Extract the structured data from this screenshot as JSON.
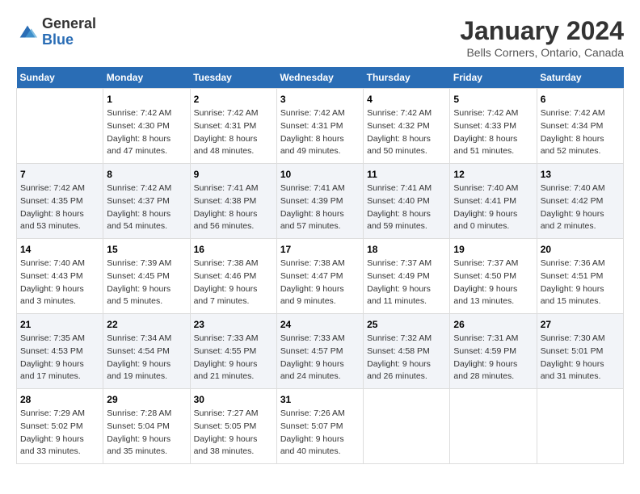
{
  "logo": {
    "general": "General",
    "blue": "Blue"
  },
  "title": "January 2024",
  "subtitle": "Bells Corners, Ontario, Canada",
  "days_of_week": [
    "Sunday",
    "Monday",
    "Tuesday",
    "Wednesday",
    "Thursday",
    "Friday",
    "Saturday"
  ],
  "weeks": [
    [
      {
        "num": "",
        "sunrise": "",
        "sunset": "",
        "daylight": ""
      },
      {
        "num": "1",
        "sunrise": "Sunrise: 7:42 AM",
        "sunset": "Sunset: 4:30 PM",
        "daylight": "Daylight: 8 hours and 47 minutes."
      },
      {
        "num": "2",
        "sunrise": "Sunrise: 7:42 AM",
        "sunset": "Sunset: 4:31 PM",
        "daylight": "Daylight: 8 hours and 48 minutes."
      },
      {
        "num": "3",
        "sunrise": "Sunrise: 7:42 AM",
        "sunset": "Sunset: 4:31 PM",
        "daylight": "Daylight: 8 hours and 49 minutes."
      },
      {
        "num": "4",
        "sunrise": "Sunrise: 7:42 AM",
        "sunset": "Sunset: 4:32 PM",
        "daylight": "Daylight: 8 hours and 50 minutes."
      },
      {
        "num": "5",
        "sunrise": "Sunrise: 7:42 AM",
        "sunset": "Sunset: 4:33 PM",
        "daylight": "Daylight: 8 hours and 51 minutes."
      },
      {
        "num": "6",
        "sunrise": "Sunrise: 7:42 AM",
        "sunset": "Sunset: 4:34 PM",
        "daylight": "Daylight: 8 hours and 52 minutes."
      }
    ],
    [
      {
        "num": "7",
        "sunrise": "Sunrise: 7:42 AM",
        "sunset": "Sunset: 4:35 PM",
        "daylight": "Daylight: 8 hours and 53 minutes."
      },
      {
        "num": "8",
        "sunrise": "Sunrise: 7:42 AM",
        "sunset": "Sunset: 4:37 PM",
        "daylight": "Daylight: 8 hours and 54 minutes."
      },
      {
        "num": "9",
        "sunrise": "Sunrise: 7:41 AM",
        "sunset": "Sunset: 4:38 PM",
        "daylight": "Daylight: 8 hours and 56 minutes."
      },
      {
        "num": "10",
        "sunrise": "Sunrise: 7:41 AM",
        "sunset": "Sunset: 4:39 PM",
        "daylight": "Daylight: 8 hours and 57 minutes."
      },
      {
        "num": "11",
        "sunrise": "Sunrise: 7:41 AM",
        "sunset": "Sunset: 4:40 PM",
        "daylight": "Daylight: 8 hours and 59 minutes."
      },
      {
        "num": "12",
        "sunrise": "Sunrise: 7:40 AM",
        "sunset": "Sunset: 4:41 PM",
        "daylight": "Daylight: 9 hours and 0 minutes."
      },
      {
        "num": "13",
        "sunrise": "Sunrise: 7:40 AM",
        "sunset": "Sunset: 4:42 PM",
        "daylight": "Daylight: 9 hours and 2 minutes."
      }
    ],
    [
      {
        "num": "14",
        "sunrise": "Sunrise: 7:40 AM",
        "sunset": "Sunset: 4:43 PM",
        "daylight": "Daylight: 9 hours and 3 minutes."
      },
      {
        "num": "15",
        "sunrise": "Sunrise: 7:39 AM",
        "sunset": "Sunset: 4:45 PM",
        "daylight": "Daylight: 9 hours and 5 minutes."
      },
      {
        "num": "16",
        "sunrise": "Sunrise: 7:38 AM",
        "sunset": "Sunset: 4:46 PM",
        "daylight": "Daylight: 9 hours and 7 minutes."
      },
      {
        "num": "17",
        "sunrise": "Sunrise: 7:38 AM",
        "sunset": "Sunset: 4:47 PM",
        "daylight": "Daylight: 9 hours and 9 minutes."
      },
      {
        "num": "18",
        "sunrise": "Sunrise: 7:37 AM",
        "sunset": "Sunset: 4:49 PM",
        "daylight": "Daylight: 9 hours and 11 minutes."
      },
      {
        "num": "19",
        "sunrise": "Sunrise: 7:37 AM",
        "sunset": "Sunset: 4:50 PM",
        "daylight": "Daylight: 9 hours and 13 minutes."
      },
      {
        "num": "20",
        "sunrise": "Sunrise: 7:36 AM",
        "sunset": "Sunset: 4:51 PM",
        "daylight": "Daylight: 9 hours and 15 minutes."
      }
    ],
    [
      {
        "num": "21",
        "sunrise": "Sunrise: 7:35 AM",
        "sunset": "Sunset: 4:53 PM",
        "daylight": "Daylight: 9 hours and 17 minutes."
      },
      {
        "num": "22",
        "sunrise": "Sunrise: 7:34 AM",
        "sunset": "Sunset: 4:54 PM",
        "daylight": "Daylight: 9 hours and 19 minutes."
      },
      {
        "num": "23",
        "sunrise": "Sunrise: 7:33 AM",
        "sunset": "Sunset: 4:55 PM",
        "daylight": "Daylight: 9 hours and 21 minutes."
      },
      {
        "num": "24",
        "sunrise": "Sunrise: 7:33 AM",
        "sunset": "Sunset: 4:57 PM",
        "daylight": "Daylight: 9 hours and 24 minutes."
      },
      {
        "num": "25",
        "sunrise": "Sunrise: 7:32 AM",
        "sunset": "Sunset: 4:58 PM",
        "daylight": "Daylight: 9 hours and 26 minutes."
      },
      {
        "num": "26",
        "sunrise": "Sunrise: 7:31 AM",
        "sunset": "Sunset: 4:59 PM",
        "daylight": "Daylight: 9 hours and 28 minutes."
      },
      {
        "num": "27",
        "sunrise": "Sunrise: 7:30 AM",
        "sunset": "Sunset: 5:01 PM",
        "daylight": "Daylight: 9 hours and 31 minutes."
      }
    ],
    [
      {
        "num": "28",
        "sunrise": "Sunrise: 7:29 AM",
        "sunset": "Sunset: 5:02 PM",
        "daylight": "Daylight: 9 hours and 33 minutes."
      },
      {
        "num": "29",
        "sunrise": "Sunrise: 7:28 AM",
        "sunset": "Sunset: 5:04 PM",
        "daylight": "Daylight: 9 hours and 35 minutes."
      },
      {
        "num": "30",
        "sunrise": "Sunrise: 7:27 AM",
        "sunset": "Sunset: 5:05 PM",
        "daylight": "Daylight: 9 hours and 38 minutes."
      },
      {
        "num": "31",
        "sunrise": "Sunrise: 7:26 AM",
        "sunset": "Sunset: 5:07 PM",
        "daylight": "Daylight: 9 hours and 40 minutes."
      },
      {
        "num": "",
        "sunrise": "",
        "sunset": "",
        "daylight": ""
      },
      {
        "num": "",
        "sunrise": "",
        "sunset": "",
        "daylight": ""
      },
      {
        "num": "",
        "sunrise": "",
        "sunset": "",
        "daylight": ""
      }
    ]
  ]
}
